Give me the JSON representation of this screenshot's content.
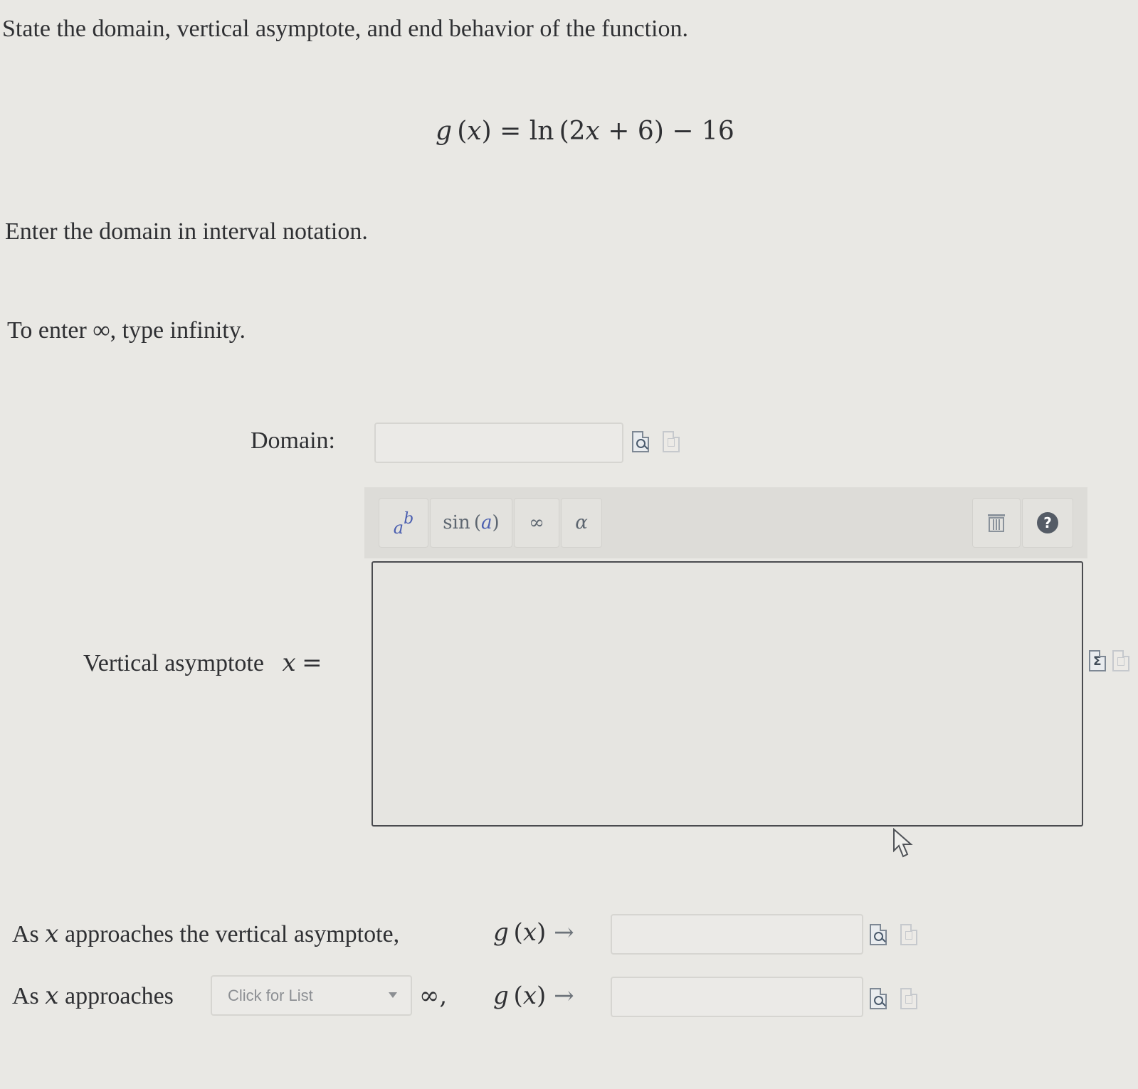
{
  "question": {
    "prompt": "State the domain, vertical asymptote, and end behavior of the function.",
    "function_lhs": "g",
    "function_var": "x",
    "function_rhs_fn": "ln",
    "function_rhs_inner_coef": "2",
    "function_rhs_inner_var": "x",
    "function_rhs_inner_rest": " + 6)",
    "function_rhs_tail": " − 16",
    "domain_instruction": "Enter the domain in interval notation.",
    "infinity_hint_prefix": "To enter ",
    "infinity_hint_symbol": "∞",
    "infinity_hint_suffix": ", type infinity."
  },
  "domain": {
    "label": "Domain:",
    "value": ""
  },
  "math_toolbar": {
    "power_base": "a",
    "power_exp": "b",
    "sin_fn": "sin",
    "sin_arg": "a",
    "infinity": "∞",
    "alpha": "α",
    "trash_icon": "trash-icon",
    "help_symbol": "?"
  },
  "asymptote": {
    "label": "Vertical asymptote",
    "var": "x",
    "eq": "=",
    "value": ""
  },
  "end_behavior": {
    "row1_prefix": "As ",
    "row1_var": "x",
    "row1_suffix": " approaches the vertical asymptote,",
    "row2_prefix": "As ",
    "row2_var": "x",
    "row2_suffix": " approaches",
    "dropdown_placeholder": "Click for List",
    "after_dropdown": "∞,",
    "g_label": "g",
    "g_var": "x",
    "arrow": "→",
    "answer1": "",
    "answer2": ""
  }
}
